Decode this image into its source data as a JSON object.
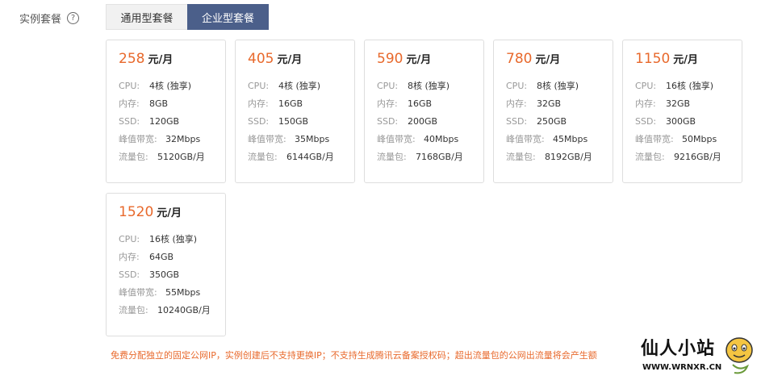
{
  "section_label": "实例套餐",
  "help_icon": "?",
  "tabs": [
    {
      "label": "通用型套餐",
      "active": false
    },
    {
      "label": "企业型套餐",
      "active": true
    }
  ],
  "spec_keys": {
    "cpu": "CPU:",
    "mem": "内存:",
    "ssd": "SSD:",
    "bw": "峰值带宽:",
    "traffic": "流量包:"
  },
  "plans": [
    {
      "price": "258",
      "unit": "元/月",
      "cpu": "4核 (独享)",
      "mem": "8GB",
      "ssd": "120GB",
      "bw": "32Mbps",
      "traffic": "5120GB/月"
    },
    {
      "price": "405",
      "unit": "元/月",
      "cpu": "4核 (独享)",
      "mem": "16GB",
      "ssd": "150GB",
      "bw": "35Mbps",
      "traffic": "6144GB/月"
    },
    {
      "price": "590",
      "unit": "元/月",
      "cpu": "8核 (独享)",
      "mem": "16GB",
      "ssd": "200GB",
      "bw": "40Mbps",
      "traffic": "7168GB/月"
    },
    {
      "price": "780",
      "unit": "元/月",
      "cpu": "8核 (独享)",
      "mem": "32GB",
      "ssd": "250GB",
      "bw": "45Mbps",
      "traffic": "8192GB/月"
    },
    {
      "price": "1150",
      "unit": "元/月",
      "cpu": "16核 (独享)",
      "mem": "32GB",
      "ssd": "300GB",
      "bw": "50Mbps",
      "traffic": "9216GB/月"
    },
    {
      "price": "1520",
      "unit": "元/月",
      "cpu": "16核 (独享)",
      "mem": "64GB",
      "ssd": "350GB",
      "bw": "55Mbps",
      "traffic": "10240GB/月"
    }
  ],
  "notice": "免费分配独立的固定公网IP，实例创建后不支持更换IP；不支持生成腾讯云备案授权码；超出流量包的公网出流量将会产生额",
  "watermark": {
    "title": "仙人小站",
    "url": "WWW.WRNXR.CN"
  },
  "colors": {
    "accent": "#e8692c",
    "active_tab": "#4b5f8a"
  }
}
